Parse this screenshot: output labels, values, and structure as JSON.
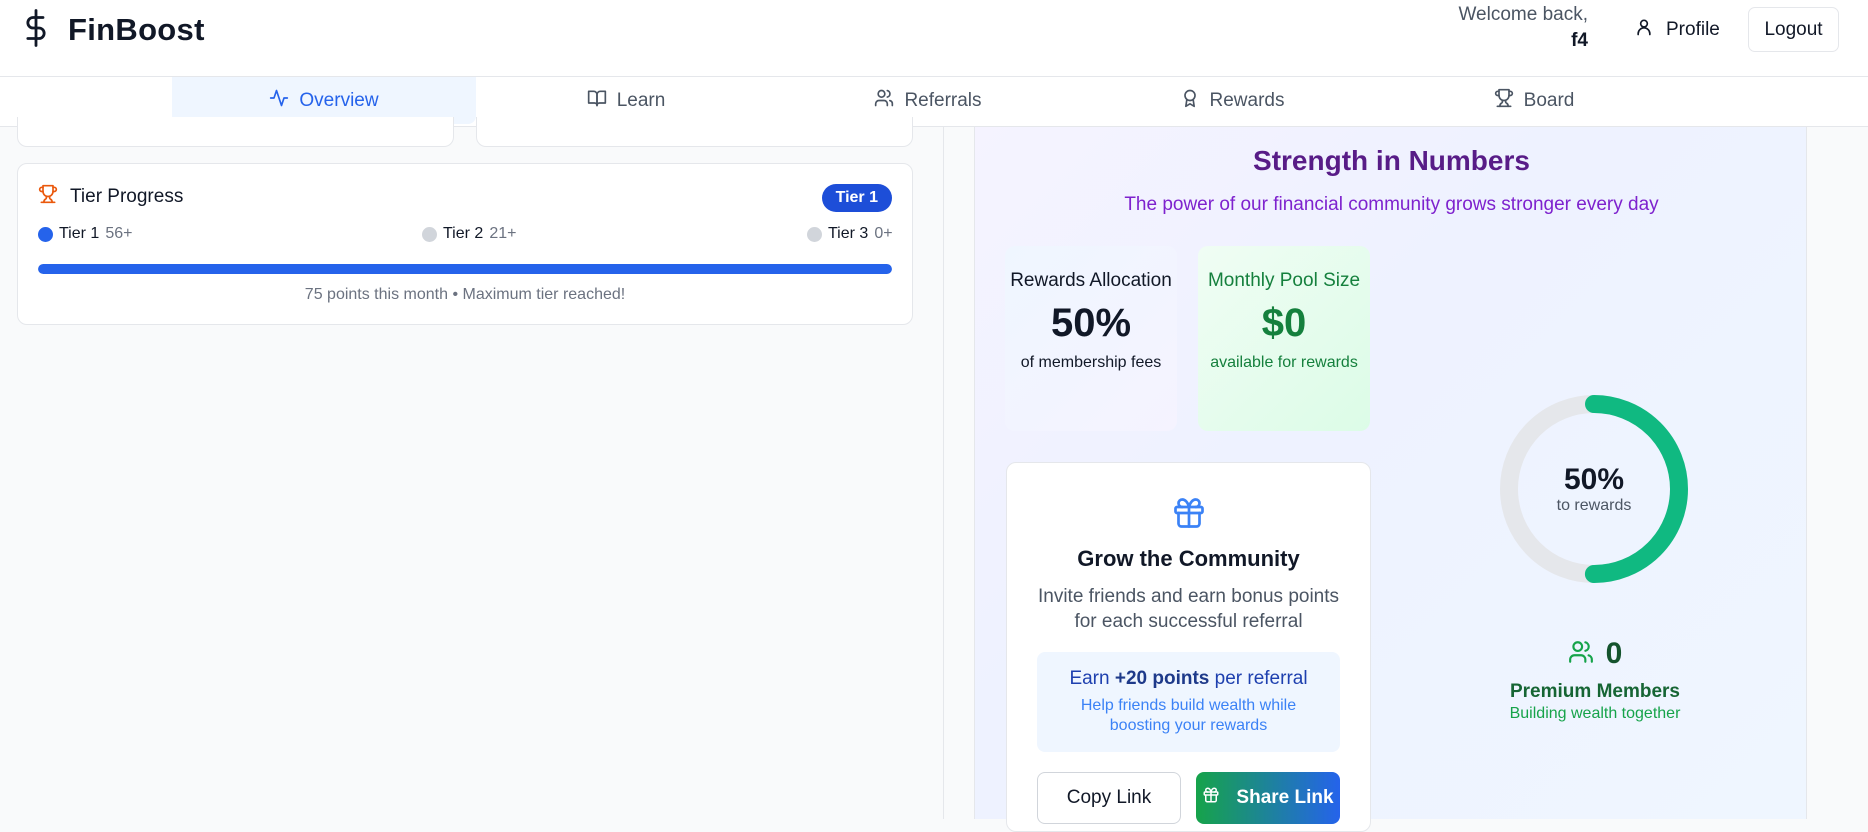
{
  "header": {
    "brand": "FinBoost",
    "welcome_text": "Welcome back,",
    "username": "f4",
    "profile_label": "Profile",
    "logout_label": "Logout"
  },
  "tabs": [
    {
      "label": "Overview",
      "icon": "activity-icon",
      "active": true
    },
    {
      "label": "Learn",
      "icon": "book-open-icon",
      "active": false
    },
    {
      "label": "Referrals",
      "icon": "users-icon",
      "active": false
    },
    {
      "label": "Rewards",
      "icon": "award-icon",
      "active": false
    },
    {
      "label": "Board",
      "icon": "trophy-icon",
      "active": false
    }
  ],
  "tier_progress": {
    "title": "Tier Progress",
    "badge": "Tier 1",
    "tiers": [
      {
        "name": "Tier 1",
        "min": "56+",
        "color": "#2563eb"
      },
      {
        "name": "Tier 2",
        "min": "21+",
        "color": "#d1d5db"
      },
      {
        "name": "Tier 3",
        "min": "0+",
        "color": "#d1d5db"
      }
    ],
    "progress_percent": 100,
    "note": "75 points this month • Maximum tier reached!"
  },
  "strength": {
    "title": "Strength in Numbers",
    "subtitle": "The power of our financial community grows stronger every day",
    "rewards_allocation": {
      "label": "Rewards Allocation",
      "value": "50%",
      "sub": "of membership fees"
    },
    "monthly_pool": {
      "label": "Monthly Pool Size",
      "value": "$0",
      "sub": "available for rewards"
    },
    "donut": {
      "value": "50%",
      "label": "to rewards",
      "fraction": 0.5,
      "color": "#10b981",
      "track_color": "#e5e7eb"
    },
    "members": {
      "count": "0",
      "label": "Premium Members",
      "sub": "Building wealth together"
    }
  },
  "grow": {
    "title": "Grow the Community",
    "description": "Invite friends and earn bonus points for each successful referral",
    "earn_prefix": "Earn ",
    "earn_points": "+20 points",
    "earn_suffix": " per referral",
    "earn_sub": "Help friends build wealth while boosting your rewards",
    "copy_label": "Copy Link",
    "share_label": "Share Link"
  },
  "colors": {
    "accent": "#2563eb",
    "purple_title": "#581c87",
    "green": "#16a34a"
  }
}
